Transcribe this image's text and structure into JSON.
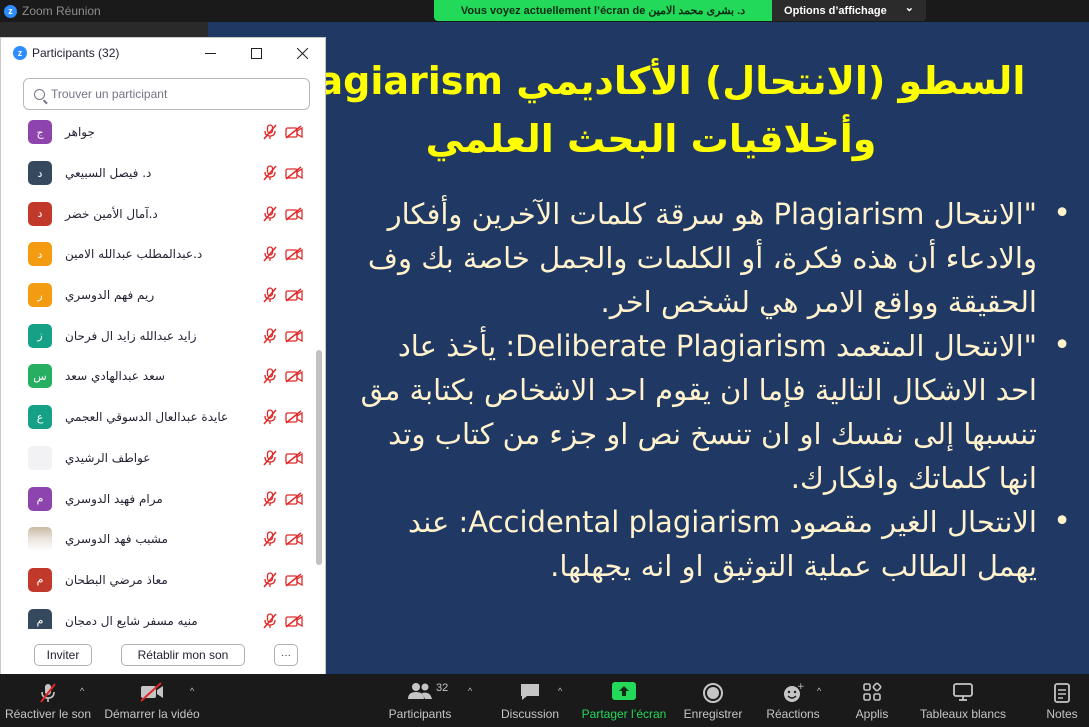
{
  "app": {
    "window_title": "Zoom Réunion"
  },
  "share_banner": {
    "text": "Vous voyez actuellement l’écran de د. بشرى محمد الامين",
    "options_label": "Options d’affichage",
    "options_caret": "⌄"
  },
  "panel": {
    "title": "Participants (32)",
    "search_placeholder": "Trouver un participant",
    "participants": [
      {
        "name": "جواهر",
        "initial": "ج",
        "color": "#8e44ad"
      },
      {
        "name": "د. فيصل السبيعي",
        "initial": "د",
        "color": "#34495e"
      },
      {
        "name": "د.آمال الأمين خضر",
        "initial": "د",
        "color": "#c0392b"
      },
      {
        "name": "د.عبدالمطلب عبدالله الامين",
        "initial": "د",
        "color": "#f39c12"
      },
      {
        "name": "ريم فهم الدوسري",
        "initial": "ر",
        "color": "#f39c12"
      },
      {
        "name": "زايد عبدالله زايد ال فرحان",
        "initial": "ز",
        "color": "#16a085"
      },
      {
        "name": "سعد عبدالهادي سعد",
        "initial": "س",
        "color": "#27ae60"
      },
      {
        "name": "عايدة عبدالعال الدسوقي العجمي",
        "initial": "ع",
        "color": "#16a085"
      },
      {
        "name": "عواطف الرشيدي",
        "initial": "",
        "color": "#f2f2f5"
      },
      {
        "name": "مرام فهيد الدوسري",
        "initial": "م",
        "color": "#8e44ad"
      },
      {
        "name": "مشبب فهد الدوسري",
        "initial": "",
        "color": "photo"
      },
      {
        "name": "معاذ مرضي البطحان",
        "initial": "م",
        "color": "#c0392b"
      },
      {
        "name": "منيه مسفر شايع ال دمجان",
        "initial": "م",
        "color": "#34495e"
      }
    ],
    "invite_label": "Inviter",
    "reclaim_label": "Rétablir mon son",
    "more_label": "···"
  },
  "slide": {
    "title_line1": "السطو (الانتحال) الأكاديمي  Plagiarism",
    "title_line2": "وأخلاقيات البحث العلمي",
    "bullet_char": "•",
    "b1_l1": "\"الانتحال Plagiarism هو سرقة كلمات الآخرين وأفكار",
    "b1_l2": "والادعاء أن هذه فكرة، أو الكلمات والجمل خاصة بك وف",
    "b1_l3": "الحقيقة وواقع الامر هي لشخص اخر.",
    "b2_l1": "\"الانتحال المتعمد Deliberate Plagiarism: يأخذ عاد",
    "b2_l2": "احد الاشكال التالية فإما ان يقوم احد الاشخاص بكتابة مق",
    "b2_l3": "تنسبها إلى نفسك او ان تنسخ نص او جزء من كتاب وتد",
    "b2_l4": "انها كلماتك وافكارك.",
    "b3_l1": "الانتحال الغير مقصود Accidental plagiarism: عند",
    "b3_l2": "يهمل الطالب عملية التوثيق او انه يجهلها."
  },
  "toolbar": {
    "mute_label": "Réactiver le son",
    "video_label": "Démarrer la vidéo",
    "participants_label": "Participants",
    "participants_count": "32",
    "discussion_label": "Discussion",
    "share_label": "Partager l’écran",
    "record_label": "Enregistrer",
    "reactions_label": "Réactions",
    "apps_label": "Applis",
    "whiteboards_label": "Tableaux blancs",
    "notes_label": "Notes",
    "caret": "^"
  },
  "colors": {
    "accent_green": "#23d959",
    "zoom_blue": "#2d8cff",
    "slide_bg": "#1f3864",
    "slide_title": "#ffff00",
    "mute_red": "#e02828"
  }
}
